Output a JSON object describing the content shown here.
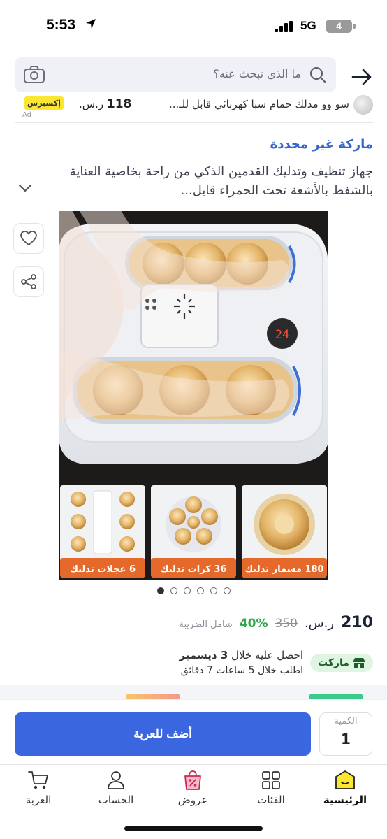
{
  "status_bar": {
    "time": "5:53",
    "network": "5G",
    "battery": "4"
  },
  "search": {
    "placeholder": "ما الذي تبحث عنه؟"
  },
  "ad": {
    "title": "سو وو مدلك حمام سبا كهربائي قابل للـ...",
    "price": "118",
    "currency": "ر.س.",
    "badge": "إكسبرس",
    "ad_label": "Ad"
  },
  "product": {
    "brand": "ماركة غير محددة",
    "title": "جهاز تنظيف وتدليك القدمين الذكي من راحة بخاصية العناية بالشفط بالأشعة تحت الحمراء قابل...",
    "image": {
      "display": "24",
      "panel_1": "180 مسمار تدليك",
      "panel_2": "36 كرات تدليك",
      "panel_3": "6 عجلات تدليك"
    },
    "image_count": 6,
    "active_image": 1
  },
  "pricing": {
    "price": "210",
    "currency": "ر.س.",
    "old_price": "350",
    "discount": "40%",
    "tax_note": "شامل الضريبة"
  },
  "delivery": {
    "badge": "ماركت",
    "line1_prefix": "احصل عليه خلال",
    "line1_date": "3 ديسمبر",
    "line2": "اطلب خلال 5 ساعات 7 دقائق"
  },
  "cart": {
    "add_label": "أضف للعربة",
    "qty_label": "الكمية",
    "qty_value": "1"
  },
  "nav": {
    "items": [
      {
        "label": "الرئيسية",
        "icon": "home-icon",
        "active": true
      },
      {
        "label": "الفئات",
        "icon": "grid-icon",
        "active": false
      },
      {
        "label": "عروض",
        "icon": "offers-icon",
        "active": false
      },
      {
        "label": "الحساب",
        "icon": "user-icon",
        "active": false
      },
      {
        "label": "العربة",
        "icon": "cart-icon",
        "active": false
      }
    ]
  },
  "colors": {
    "accent": "#3a67e0",
    "brand_link": "#3766c9",
    "discount": "#2ea84a",
    "express_badge": "#fbe632",
    "home_icon_fill": "#fbe632"
  }
}
